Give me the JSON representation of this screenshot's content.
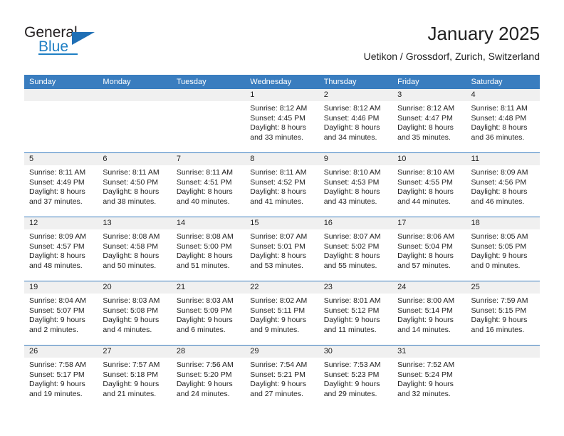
{
  "brand": {
    "name_top": "General",
    "name_bottom": "Blue",
    "triangle_icon": "triangle-icon",
    "accent_color": "#1f7fc4"
  },
  "header": {
    "month_title": "January 2025",
    "location": "Uetikon / Grossdorf, Zurich, Switzerland"
  },
  "calendar": {
    "header_color": "#3a7dbf",
    "day_band_color": "#f0f0f0",
    "weekdays": [
      "Sunday",
      "Monday",
      "Tuesday",
      "Wednesday",
      "Thursday",
      "Friday",
      "Saturday"
    ],
    "weeks": [
      [
        {
          "empty": true
        },
        {
          "empty": true
        },
        {
          "empty": true
        },
        {
          "day": "1",
          "sunrise": "Sunrise: 8:12 AM",
          "sunset": "Sunset: 4:45 PM",
          "daylight": "Daylight: 8 hours and 33 minutes."
        },
        {
          "day": "2",
          "sunrise": "Sunrise: 8:12 AM",
          "sunset": "Sunset: 4:46 PM",
          "daylight": "Daylight: 8 hours and 34 minutes."
        },
        {
          "day": "3",
          "sunrise": "Sunrise: 8:12 AM",
          "sunset": "Sunset: 4:47 PM",
          "daylight": "Daylight: 8 hours and 35 minutes."
        },
        {
          "day": "4",
          "sunrise": "Sunrise: 8:11 AM",
          "sunset": "Sunset: 4:48 PM",
          "daylight": "Daylight: 8 hours and 36 minutes."
        }
      ],
      [
        {
          "day": "5",
          "sunrise": "Sunrise: 8:11 AM",
          "sunset": "Sunset: 4:49 PM",
          "daylight": "Daylight: 8 hours and 37 minutes."
        },
        {
          "day": "6",
          "sunrise": "Sunrise: 8:11 AM",
          "sunset": "Sunset: 4:50 PM",
          "daylight": "Daylight: 8 hours and 38 minutes."
        },
        {
          "day": "7",
          "sunrise": "Sunrise: 8:11 AM",
          "sunset": "Sunset: 4:51 PM",
          "daylight": "Daylight: 8 hours and 40 minutes."
        },
        {
          "day": "8",
          "sunrise": "Sunrise: 8:11 AM",
          "sunset": "Sunset: 4:52 PM",
          "daylight": "Daylight: 8 hours and 41 minutes."
        },
        {
          "day": "9",
          "sunrise": "Sunrise: 8:10 AM",
          "sunset": "Sunset: 4:53 PM",
          "daylight": "Daylight: 8 hours and 43 minutes."
        },
        {
          "day": "10",
          "sunrise": "Sunrise: 8:10 AM",
          "sunset": "Sunset: 4:55 PM",
          "daylight": "Daylight: 8 hours and 44 minutes."
        },
        {
          "day": "11",
          "sunrise": "Sunrise: 8:09 AM",
          "sunset": "Sunset: 4:56 PM",
          "daylight": "Daylight: 8 hours and 46 minutes."
        }
      ],
      [
        {
          "day": "12",
          "sunrise": "Sunrise: 8:09 AM",
          "sunset": "Sunset: 4:57 PM",
          "daylight": "Daylight: 8 hours and 48 minutes."
        },
        {
          "day": "13",
          "sunrise": "Sunrise: 8:08 AM",
          "sunset": "Sunset: 4:58 PM",
          "daylight": "Daylight: 8 hours and 50 minutes."
        },
        {
          "day": "14",
          "sunrise": "Sunrise: 8:08 AM",
          "sunset": "Sunset: 5:00 PM",
          "daylight": "Daylight: 8 hours and 51 minutes."
        },
        {
          "day": "15",
          "sunrise": "Sunrise: 8:07 AM",
          "sunset": "Sunset: 5:01 PM",
          "daylight": "Daylight: 8 hours and 53 minutes."
        },
        {
          "day": "16",
          "sunrise": "Sunrise: 8:07 AM",
          "sunset": "Sunset: 5:02 PM",
          "daylight": "Daylight: 8 hours and 55 minutes."
        },
        {
          "day": "17",
          "sunrise": "Sunrise: 8:06 AM",
          "sunset": "Sunset: 5:04 PM",
          "daylight": "Daylight: 8 hours and 57 minutes."
        },
        {
          "day": "18",
          "sunrise": "Sunrise: 8:05 AM",
          "sunset": "Sunset: 5:05 PM",
          "daylight": "Daylight: 9 hours and 0 minutes."
        }
      ],
      [
        {
          "day": "19",
          "sunrise": "Sunrise: 8:04 AM",
          "sunset": "Sunset: 5:07 PM",
          "daylight": "Daylight: 9 hours and 2 minutes."
        },
        {
          "day": "20",
          "sunrise": "Sunrise: 8:03 AM",
          "sunset": "Sunset: 5:08 PM",
          "daylight": "Daylight: 9 hours and 4 minutes."
        },
        {
          "day": "21",
          "sunrise": "Sunrise: 8:03 AM",
          "sunset": "Sunset: 5:09 PM",
          "daylight": "Daylight: 9 hours and 6 minutes."
        },
        {
          "day": "22",
          "sunrise": "Sunrise: 8:02 AM",
          "sunset": "Sunset: 5:11 PM",
          "daylight": "Daylight: 9 hours and 9 minutes."
        },
        {
          "day": "23",
          "sunrise": "Sunrise: 8:01 AM",
          "sunset": "Sunset: 5:12 PM",
          "daylight": "Daylight: 9 hours and 11 minutes."
        },
        {
          "day": "24",
          "sunrise": "Sunrise: 8:00 AM",
          "sunset": "Sunset: 5:14 PM",
          "daylight": "Daylight: 9 hours and 14 minutes."
        },
        {
          "day": "25",
          "sunrise": "Sunrise: 7:59 AM",
          "sunset": "Sunset: 5:15 PM",
          "daylight": "Daylight: 9 hours and 16 minutes."
        }
      ],
      [
        {
          "day": "26",
          "sunrise": "Sunrise: 7:58 AM",
          "sunset": "Sunset: 5:17 PM",
          "daylight": "Daylight: 9 hours and 19 minutes."
        },
        {
          "day": "27",
          "sunrise": "Sunrise: 7:57 AM",
          "sunset": "Sunset: 5:18 PM",
          "daylight": "Daylight: 9 hours and 21 minutes."
        },
        {
          "day": "28",
          "sunrise": "Sunrise: 7:56 AM",
          "sunset": "Sunset: 5:20 PM",
          "daylight": "Daylight: 9 hours and 24 minutes."
        },
        {
          "day": "29",
          "sunrise": "Sunrise: 7:54 AM",
          "sunset": "Sunset: 5:21 PM",
          "daylight": "Daylight: 9 hours and 27 minutes."
        },
        {
          "day": "30",
          "sunrise": "Sunrise: 7:53 AM",
          "sunset": "Sunset: 5:23 PM",
          "daylight": "Daylight: 9 hours and 29 minutes."
        },
        {
          "day": "31",
          "sunrise": "Sunrise: 7:52 AM",
          "sunset": "Sunset: 5:24 PM",
          "daylight": "Daylight: 9 hours and 32 minutes."
        },
        {
          "empty": true
        }
      ]
    ]
  }
}
